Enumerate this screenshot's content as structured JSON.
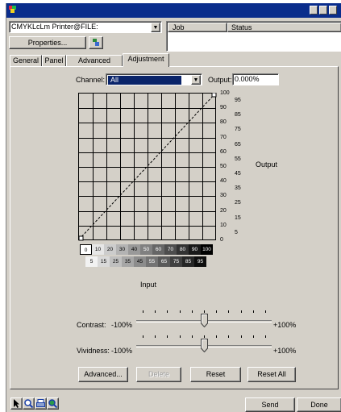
{
  "printer": {
    "selected": "CMYKLcLm Printer@FILE:"
  },
  "toolbar": {
    "properties_label": "Properties..."
  },
  "job_list": {
    "columns": [
      "Job",
      "Status"
    ]
  },
  "tabs": [
    {
      "label": "General"
    },
    {
      "label": "Panel"
    },
    {
      "label": "Advanced"
    },
    {
      "label": "Adjustment",
      "active": true
    }
  ],
  "adjustment": {
    "channel_label": "Channel:",
    "channel_value": "All",
    "output_label": "Output:",
    "output_value": "0.000%",
    "input_axis_label": "Input",
    "output_axis_label": "Output",
    "right_ticks_a": [
      "100",
      "90",
      "80",
      "70",
      "60",
      "50",
      "40",
      "30",
      "20",
      "10",
      "0"
    ],
    "right_ticks_b": [
      "95",
      "85",
      "75",
      "65",
      "55",
      "45",
      "35",
      "25",
      "15",
      "5"
    ],
    "bottom_ticks_a": [
      "0",
      "10",
      "20",
      "30",
      "40",
      "50",
      "60",
      "70",
      "80",
      "90",
      "100"
    ],
    "bottom_ticks_b": [
      "5",
      "15",
      "25",
      "35",
      "45",
      "55",
      "65",
      "75",
      "85",
      "95"
    ],
    "contrast": {
      "label": "Contrast:",
      "min": "-100%",
      "max": "+100%",
      "value_fraction": 0.5
    },
    "vividness": {
      "label": "Vividness:",
      "min": "-100%",
      "max": "+100%",
      "value_fraction": 0.5
    },
    "buttons": {
      "advanced": "Advanced...",
      "delete": "Delete",
      "reset": "Reset",
      "reset_all": "Reset All"
    }
  },
  "footer": {
    "send": "Send",
    "done": "Done"
  },
  "tools": [
    "arrow-tool-icon",
    "zoom-tool-icon",
    "printer-tool-icon",
    "zoom-fit-tool-icon"
  ]
}
